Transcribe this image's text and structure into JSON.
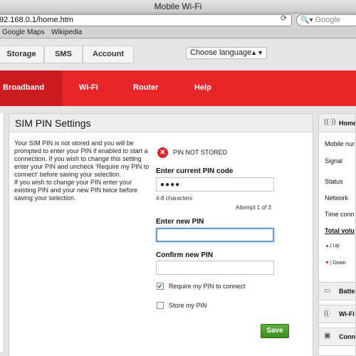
{
  "browser": {
    "window_title": "Mobile Wi-Fi",
    "url": "92.168.0.1/home.htm",
    "search_placeholder": "Google",
    "bookmarks": [
      "Google Maps",
      "Wikipedia"
    ]
  },
  "topnav": {
    "tabs": [
      "Storage",
      "SMS",
      "Account"
    ],
    "language_select": "Choose language"
  },
  "mainnav": {
    "items": [
      "Broadband",
      "Wi-Fi",
      "Router",
      "Help"
    ],
    "active": "Broadband"
  },
  "panel": {
    "title": "SIM PIN Settings",
    "description": "Your SIM PIN is not stored and you will be prompted to enter your PIN if enabled to start a connection. If you wish to change this setting enter your PIN and uncheck 'Require my PIN to connect' before saving your selection.\nIf you wish to change your PIN enter your existing PIN and your new PIN twice before saving your selection.",
    "status": "PIN NOT STORED",
    "current_pin_label": "Enter current PIN code",
    "current_pin_value": "●●●●",
    "hint": "4-8 characters",
    "attempt": "Attempt 1 of 3",
    "new_pin_label": "Enter new PIN",
    "confirm_pin_label": "Confirm new PIN",
    "require_pin_label": "Require my PIN to connect",
    "require_pin_checked": true,
    "store_pin_label": "Store my PIN",
    "store_pin_checked": false,
    "save_label": "Save"
  },
  "sidebar": {
    "home": "Home",
    "mobile_number": "Mobile nur",
    "signal": "Signal",
    "status": "Status",
    "network": "Network",
    "time_connected": "Time conn",
    "total_volume": "Total volu",
    "up": "| Up",
    "down": "| Down",
    "battery": "Batte",
    "wifi": "Wi-Fi",
    "connected": "Conn"
  },
  "colors": {
    "brand_red": "#e8262a",
    "save_green": "#4a9c2c"
  }
}
